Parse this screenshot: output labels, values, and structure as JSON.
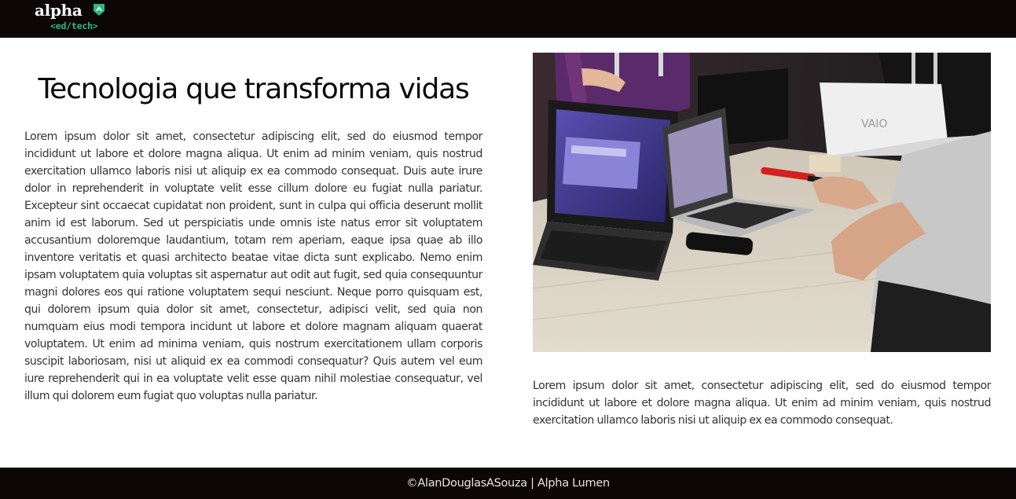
{
  "brand": {
    "logo_word": "alpha",
    "logo_sub": "<ed/tech>",
    "badge_icon": "leaf-badge-icon",
    "accent_color": "#2fb87c"
  },
  "main": {
    "title": "Tecnologia que transforma vidas",
    "body": "Lorem ipsum dolor sit amet, consectetur adipiscing elit, sed do eiusmod tempor incididunt ut labore et dolore magna aliqua. Ut enim ad minim veniam, quis nostrud exercitation ullamco laboris nisi ut aliquip ex ea commodo consequat. Duis aute irure dolor in reprehenderit in voluptate velit esse cillum dolore eu fugiat nulla pariatur. Excepteur sint occaecat cupidatat non proident, sunt in culpa qui officia deserunt mollit anim id est laborum. Sed ut perspiciatis unde omnis iste natus error sit voluptatem accusantium doloremque laudantium, totam rem aperiam, eaque ipsa quae ab illo inventore veritatis et quasi architecto beatae vitae dicta sunt explicabo. Nemo enim ipsam voluptatem quia voluptas sit aspernatur aut odit aut fugit, sed quia consequuntur magni dolores eos qui ratione voluptatem sequi nesciunt. Neque porro quisquam est, qui dolorem ipsum quia dolor sit amet, consectetur, adipisci velit, sed quia non numquam eius modi tempora incidunt ut labore et dolore magnam aliquam quaerat voluptatem. Ut enim ad minima veniam, quis nostrum exercitationem ullam corporis suscipit laboriosam, nisi ut aliquid ex ea commodi consequatur? Quis autem vel eum iure reprehenderit qui in ea voluptate velit esse quam nihil molestiae consequatur, vel illum qui dolorem eum fugiat quo voluptas nulla pariatur."
  },
  "aside": {
    "photo_laptop_brand": "VAIO",
    "caption": "Lorem ipsum dolor sit amet, consectetur adipiscing elit, sed do eiusmod tempor incididunt ut labore et dolore magna aliqua. Ut enim ad minim veniam, quis nostrud exercitation ullamco laboris nisi ut aliquip ex ea commodo consequat."
  },
  "footer": {
    "text": "©AlanDouglasASouza | Alpha Lumen"
  },
  "colors": {
    "bar_background": "#0d0606",
    "page_background": "#ffffff"
  }
}
